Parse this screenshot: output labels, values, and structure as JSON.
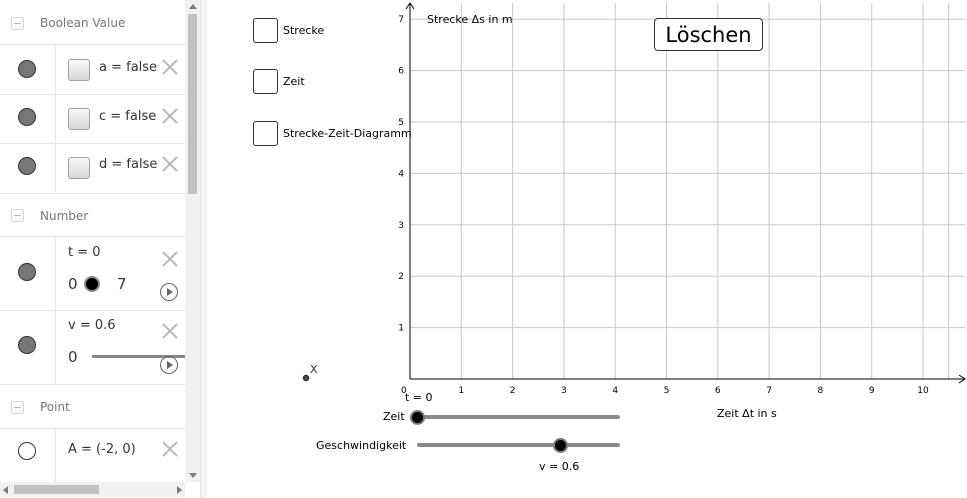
{
  "algebra": {
    "sections": [
      {
        "title": "Boolean Value"
      },
      {
        "title": "Number"
      },
      {
        "title": "Point"
      }
    ],
    "booleans": [
      {
        "text": "a = false"
      },
      {
        "text": "c = false"
      },
      {
        "text": "d = false"
      }
    ],
    "numbers": [
      {
        "text": "t = 0",
        "min": "0",
        "max": "7",
        "value": 0,
        "range": [
          0,
          7
        ]
      },
      {
        "text": "v = 0.6",
        "min": "0",
        "max": "",
        "value": 0.6
      }
    ],
    "points": [
      {
        "text": "A = (-2, 0)"
      }
    ]
  },
  "graphics": {
    "checkboxes": [
      {
        "label": "Strecke"
      },
      {
        "label": "Zeit"
      },
      {
        "label": "Strecke-Zeit-Diagramm"
      }
    ],
    "clear_button_label": "Löschen",
    "point_label": "X",
    "axis": {
      "y_label": "Strecke Δs in m",
      "x_label": "Zeit Δt in s",
      "x_ticks": [
        "0",
        "1",
        "2",
        "3",
        "4",
        "5",
        "6",
        "7",
        "8",
        "9",
        "10"
      ],
      "y_ticks": [
        "1",
        "2",
        "3",
        "4",
        "5",
        "6",
        "7"
      ],
      "x_range": [
        0,
        10.9
      ],
      "y_range": [
        0,
        7.3
      ]
    },
    "sliders": {
      "time": {
        "label": "Zeit",
        "caption": "t = 0",
        "value": 0,
        "range": [
          0,
          7
        ]
      },
      "speed": {
        "label": "Geschwindigkeit",
        "caption": "v = 0.6",
        "value": 0.6,
        "range": [
          0,
          0.85
        ]
      }
    }
  },
  "colors": {
    "grid": "#c8c8c8",
    "axis": "#000000",
    "marble_filled": "#777777",
    "slider_track": "#8a8a8a"
  }
}
